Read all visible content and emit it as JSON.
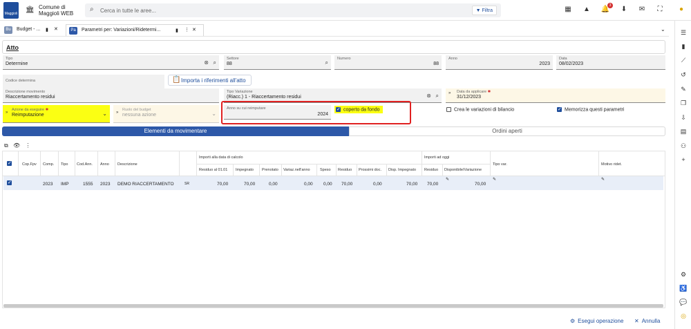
{
  "header": {
    "logo_text": "Maggioli",
    "org_line1": "Comune di",
    "org_line2": "Maggioli WEB",
    "search_placeholder": "Cerca in tutte le aree...",
    "filter_label": "Filtra",
    "notification_count": "3"
  },
  "tabs": [
    {
      "label": "Budget - ...",
      "icon_text": "Bu"
    },
    {
      "label": "Parametri per: Variazioni/Ridetermi...",
      "icon_text": "Pa"
    }
  ],
  "atto": {
    "section_title": "Atto",
    "tipo_label": "Tipo",
    "tipo_value": "Determine",
    "settore_label": "Settore",
    "settore_value": "88",
    "numero_label": "Numero",
    "numero_value": "88",
    "anno_label": "Anno",
    "anno_value": "2023",
    "data_label": "Data",
    "data_value": "08/02/2023",
    "codice_label": "Codice determina",
    "import_button": "Importa i riferimenti all'atto"
  },
  "movimento": {
    "descrizione_label": "Descrizione movimento",
    "descrizione_value": "Riaccertamento residui",
    "tipo_variazione_label": "Tipo Variazione",
    "tipo_variazione_value": "(Riacc.) 1 - Riaccertamento residui",
    "data_applicare_label": "Data da applicare",
    "data_applicare_value": "31/12/2023",
    "azione_label": "Azione da eseguire",
    "azione_value": "Reimputazione",
    "ruolo_label": "Ruolo del budget",
    "ruolo_value": "nessuna azione",
    "anno_reimputare_label": "Anno su cui reimputare",
    "anno_reimputare_value": "2024",
    "coperto_label": "coperto da fondo",
    "crea_label": "Crea le variazioni di bilancio",
    "memorizza_label": "Memorizza questi parametri"
  },
  "subtabs": [
    "Elementi da movimentare",
    "Ordini aperti"
  ],
  "grid": {
    "group_calcolo": "Importi alla data di calcolo",
    "group_oggi": "Importi ad oggi",
    "headers": [
      "Cop.Fpv",
      "Comp.",
      "Tipo",
      "Cod.Ann.",
      "Anno",
      "Descrizione",
      "Residuo al 01.01",
      "Impegnato",
      "Prenotato",
      "Variaz.nell'anno",
      "Speso",
      "Residuo",
      "Prossimi doc.",
      "Disp. Impegnato",
      "Residuo",
      "Disponibile/Variazione",
      "Tipo var.",
      "Motivo ridet."
    ],
    "row": [
      "",
      "2023",
      "IMP",
      "1555",
      "2023",
      "DEMO RIACCERTAMENTO",
      "70,00",
      "70,00",
      "0,00",
      "0,00",
      "0,00",
      "70,00",
      "0,00",
      "70,00",
      "70,00",
      "70,00",
      "",
      ""
    ]
  },
  "footer": {
    "execute_label": "Esegui operazione",
    "cancel_label": "Annulla"
  }
}
